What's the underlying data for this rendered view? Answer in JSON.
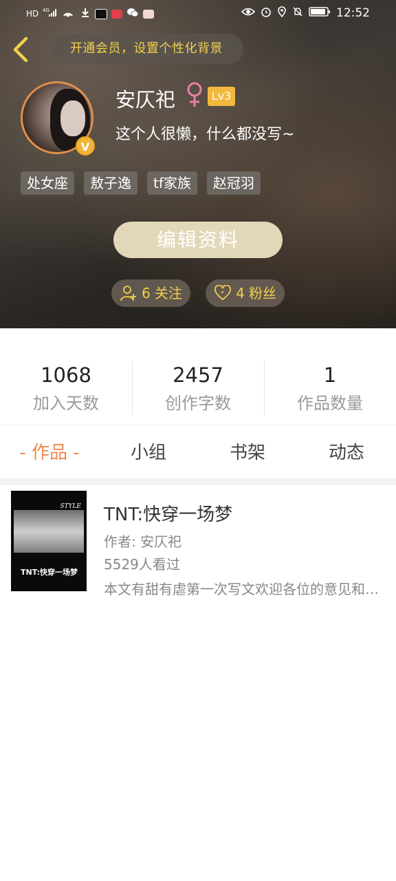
{
  "status_bar": {
    "left_text": [
      "HD",
      "4G",
      "1"
    ],
    "time": "12:52"
  },
  "header": {
    "vip_banner": "开通会员，设置个性化背景",
    "username": "安仄祀",
    "gender_symbol": "♀",
    "level": "Lv3",
    "bio": "这个人很懒，什么都没写~",
    "tags": [
      "处女座",
      "敖子逸",
      "tf家族",
      "赵冠羽"
    ],
    "edit_button": "编辑资料",
    "follow_count": "6",
    "follow_label": "关注",
    "fans_count": "4",
    "fans_label": "粉丝",
    "accent_color": "#f2cf4a"
  },
  "stats": [
    {
      "value": "1068",
      "label": "加入天数"
    },
    {
      "value": "2457",
      "label": "创作字数"
    },
    {
      "value": "1",
      "label": "作品数量"
    }
  ],
  "tabs": [
    {
      "label": "- 作品 -",
      "active": true
    },
    {
      "label": "小组",
      "active": false
    },
    {
      "label": "书架",
      "active": false
    },
    {
      "label": "动态",
      "active": false
    }
  ],
  "works": [
    {
      "title": "TNT:快穿一场梦",
      "author": "作者: 安仄祀",
      "views": "5529人看过",
      "description": "本文有甜有虐第一次写文欢迎各位的意见和建议",
      "cover_style_text": "STYLE",
      "cover_title": "TNT:快穿一场梦"
    }
  ]
}
